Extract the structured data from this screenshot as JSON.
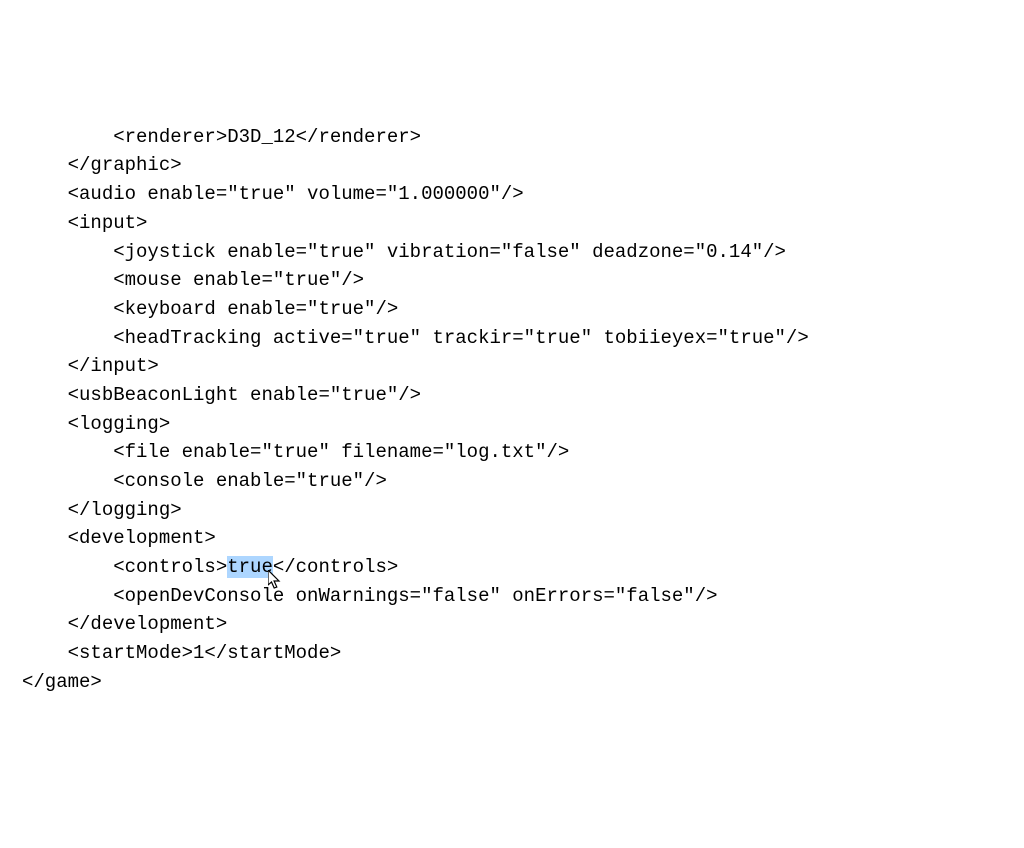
{
  "lines": {
    "l0": "        <renderer>D3D_12</renderer>",
    "l1": "    </graphic>",
    "l2": "    <audio enable=\"true\" volume=\"1.000000\"/>",
    "l3": "    <input>",
    "l4": "        <joystick enable=\"true\" vibration=\"false\" deadzone=\"0.14\"/>",
    "l5": "        <mouse enable=\"true\"/>",
    "l6": "        <keyboard enable=\"true\"/>",
    "l7": "        <headTracking active=\"true\" trackir=\"true\" tobiieyex=\"true\"/>",
    "l8": "    </input>",
    "l9": "    <usbBeaconLight enable=\"true\"/>",
    "l10": "    <logging>",
    "l11": "        <file enable=\"true\" filename=\"log.txt\"/>",
    "l12": "        <console enable=\"true\"/>",
    "l13": "    </logging>",
    "l14": "    <development>",
    "l15_prefix": "        <controls>",
    "l15_highlight": "true",
    "l15_suffix": "</controls>",
    "l16": "        <openDevConsole onWarnings=\"false\" onErrors=\"false\"/>",
    "l17": "    </development>",
    "l18": "    <startMode>1</startMode>",
    "l19": "</game>"
  }
}
